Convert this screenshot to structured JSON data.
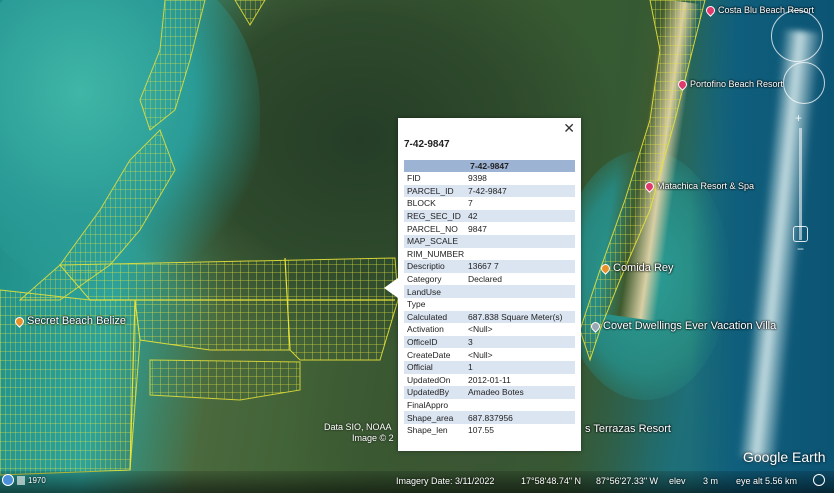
{
  "popup": {
    "close_label": "✕",
    "title": "7-42-9847",
    "table_header": "7-42-9847",
    "rows": [
      {
        "key": "FID",
        "value": "9398"
      },
      {
        "key": "PARCEL_ID",
        "value": "7-42-9847"
      },
      {
        "key": "BLOCK",
        "value": "7"
      },
      {
        "key": "REG_SEC_ID",
        "value": "42"
      },
      {
        "key": "PARCEL_NO",
        "value": "9847"
      },
      {
        "key": "MAP_SCALE",
        "value": ""
      },
      {
        "key": "RIM_NUMBER",
        "value": ""
      },
      {
        "key": "Descriptio",
        "value": "13667 7"
      },
      {
        "key": "Category",
        "value": "Declared"
      },
      {
        "key": "LandUse",
        "value": ""
      },
      {
        "key": "Type",
        "value": ""
      },
      {
        "key": "Calculated",
        "value": "687.838 Square Meter(s)"
      },
      {
        "key": "Activation",
        "value": "<Null>"
      },
      {
        "key": "OfficeID",
        "value": "3"
      },
      {
        "key": "CreateDate",
        "value": "<Null>"
      },
      {
        "key": "Official",
        "value": "1"
      },
      {
        "key": "UpdatedOn",
        "value": "2012-01-11"
      },
      {
        "key": "UpdatedBy",
        "value": "Amadeo Botes"
      },
      {
        "key": "FinalAppro",
        "value": ""
      },
      {
        "key": "Shape_area",
        "value": "687.837956"
      },
      {
        "key": "Shape_len",
        "value": "107.55"
      }
    ]
  },
  "places": {
    "costa_blu": "Costa Blu Beach Resort",
    "portofino": "Portofino Beach Resort",
    "matachica": "Matachica Resort & Spa",
    "comida_rey": "Comida Rey",
    "covet": "Covet Dwellings Ever Vacation Villa",
    "secret_beach": "Secret Beach Belize",
    "terrazas": "s Terrazas Resort"
  },
  "attribution": {
    "line1": "Data SIO, NOAA",
    "line2": "Image © 2"
  },
  "logo": "Google Earth",
  "status": {
    "year": "1970",
    "imagery_date": "Imagery Date: 3/11/2022",
    "lat": "17°58'48.74\" N",
    "lon": "87°56'27.33\" W",
    "elev_label": "elev",
    "elev_value": "3 m",
    "eye_alt": "eye alt  5.56 km"
  },
  "colors": {
    "parcel_lines": "#e8e33a",
    "hotel_pin": "#e0396b",
    "food_pin": "#e8902a",
    "lodging_pin": "#9aa7b5",
    "table_header": "#9db3d4",
    "row_alt": "#dbe5f2"
  },
  "icons": {
    "hotel": "hotel-pin-icon",
    "food": "restaurant-pin-icon",
    "lodging": "lodging-pin-icon",
    "close": "close-icon",
    "history": "historical-imagery-icon",
    "tour": "tour-icon",
    "compass": "compass-icon"
  }
}
